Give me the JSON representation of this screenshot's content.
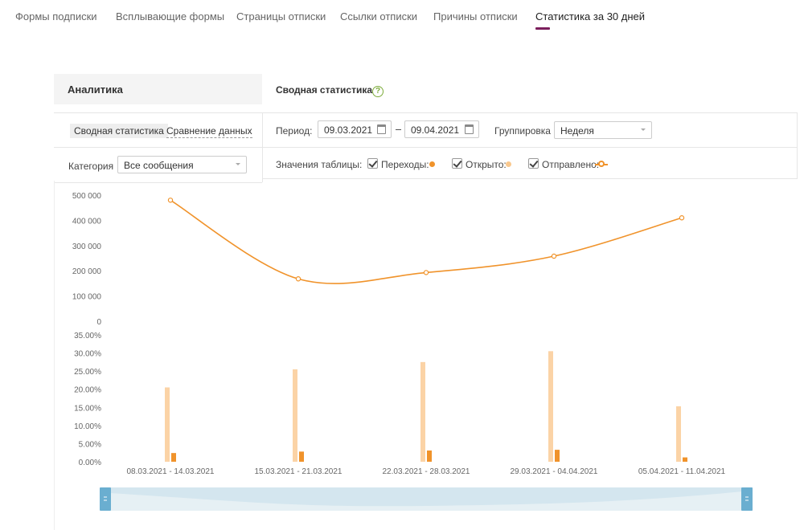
{
  "tabs": [
    {
      "label": "Формы подписки",
      "active": false
    },
    {
      "label": "Всплывающие формы",
      "active": false
    },
    {
      "label": "Страницы отписки",
      "active": false
    },
    {
      "label": "Ссылки отписки",
      "active": false
    },
    {
      "label": "Причины отписки",
      "active": false
    },
    {
      "label": "Статистика за 30 дней",
      "active": true
    }
  ],
  "left_panel": {
    "title": "Аналитика",
    "subtabs": [
      "Сводная статистика",
      "Сравнение данных"
    ],
    "category_label": "Категория",
    "category_value": "Все сообщения"
  },
  "right_panel": {
    "title": "Сводная статистика",
    "help_icon": "question-icon",
    "period_label": "Период:",
    "date_from": "09.03.2021",
    "date_to": "09.04.2021",
    "grouping_label": "Группировка",
    "grouping_value": "Неделя",
    "table_values_label": "Значения таблицы:",
    "legend": [
      {
        "label": "Переходы:",
        "checked": true,
        "color": "#f0932b",
        "marker": "dot"
      },
      {
        "label": "Открыто:",
        "checked": true,
        "color": "#f9c88e",
        "marker": "dot"
      },
      {
        "label": "Отправлено:",
        "checked": true,
        "color": "#f0932b",
        "marker": "line-ring"
      }
    ]
  },
  "colors": {
    "accent_underline": "#7b1e5c",
    "line": "#f0932b",
    "bar_opened": "#fbd3a6",
    "bar_clicks": "#f0932b",
    "navigator": "#d4e6ef",
    "navigator_handle": "#6aaed0"
  },
  "chart_data": [
    {
      "type": "line",
      "series": [
        {
          "name": "Отправлено",
          "values": [
            480000,
            168000,
            193000,
            258000,
            410000
          ]
        }
      ],
      "categories": [
        "08.03.2021 - 14.03.2021",
        "15.03.2021 - 21.03.2021",
        "22.03.2021 - 28.03.2021",
        "29.03.2021 - 04.04.2021",
        "05.04.2021 - 11.04.2021"
      ],
      "y_ticks": [
        "500 000",
        "400 000",
        "300 000",
        "200 000",
        "100 000",
        "0"
      ],
      "ylim": [
        0,
        500000
      ]
    },
    {
      "type": "bar",
      "categories": [
        "08.03.2021 - 14.03.2021",
        "15.03.2021 - 21.03.2021",
        "22.03.2021 - 28.03.2021",
        "29.03.2021 - 04.04.2021",
        "05.04.2021 - 11.04.2021"
      ],
      "series": [
        {
          "name": "Открыто",
          "values": [
            20.5,
            25.5,
            27.5,
            30.5,
            15.3
          ]
        },
        {
          "name": "Переходы",
          "values": [
            2.4,
            2.8,
            3.1,
            3.3,
            1.2
          ]
        }
      ],
      "y_ticks": [
        "35.00%",
        "30.00%",
        "25.00%",
        "20.00%",
        "15.00%",
        "10.00%",
        "5.00%",
        "0.00%"
      ],
      "ylim": [
        0,
        35
      ]
    }
  ]
}
